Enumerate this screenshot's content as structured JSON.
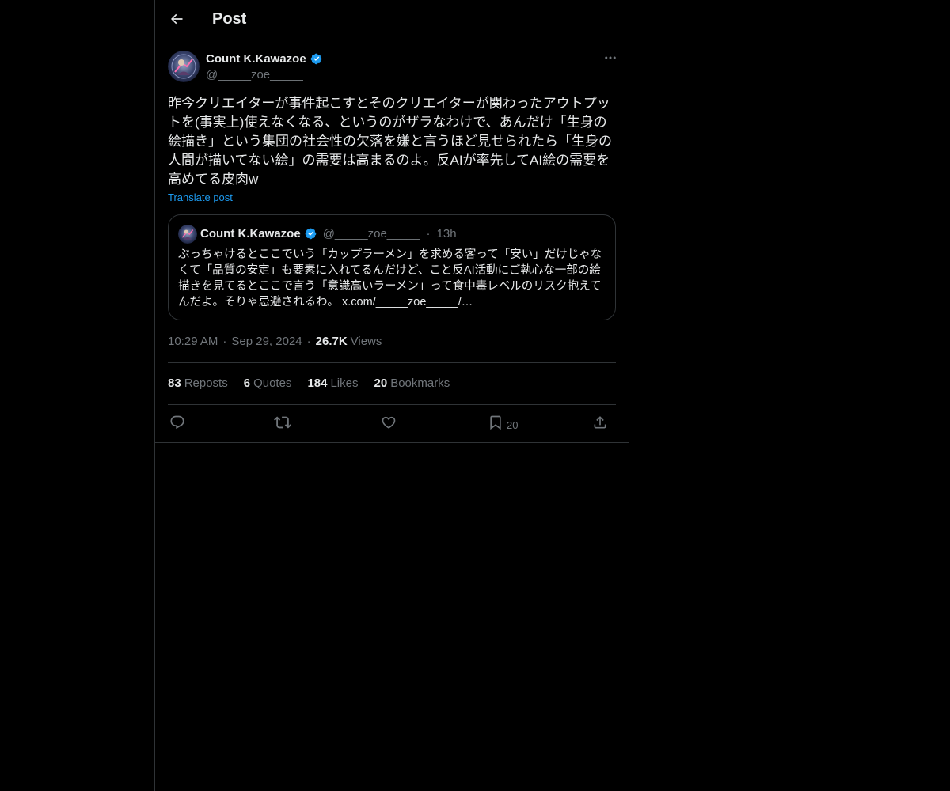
{
  "header": {
    "title": "Post"
  },
  "post": {
    "author_name": "Count K.Kawazoe",
    "author_handle": "@_____zoe_____",
    "text": "昨今クリエイターが事件起こすとそのクリエイターが関わったアウトプットを(事実上)使えなくなる、というのがザラなわけで、あんだけ「生身の絵描き」という集団の社会性の欠落を嫌と言うほど見せられたら「生身の人間が描いてない絵」の需要は高まるのよ。反AIが率先してAI絵の需要を高めてる皮肉w",
    "translate_label": "Translate post",
    "time": "10:29 AM",
    "date": "Sep 29, 2024",
    "views_count": "26.7K",
    "views_label": "Views"
  },
  "quote": {
    "author_name": "Count K.Kawazoe",
    "author_handle": "@_____zoe_____",
    "dot": "·",
    "time": "13h",
    "text": "ぶっちゃけるとここでいう「カップラーメン」を求める客って「安い」だけじゃなくて「品質の安定」も要素に入れてるんだけど、こと反AI活動にご執心な一部の絵描きを見てるとここで言う「意識高いラーメン」って食中毒レベルのリスク抱えてんだよ。そりゃ忌避されるわ。 x.com/_____zoe_____/…"
  },
  "meta_sep": "·",
  "stats": {
    "reposts": {
      "count": "83",
      "label": "Reposts"
    },
    "quotes": {
      "count": "6",
      "label": "Quotes"
    },
    "likes": {
      "count": "184",
      "label": "Likes"
    },
    "bookmarks": {
      "count": "20",
      "label": "Bookmarks"
    }
  },
  "actions": {
    "bookmark_count": "20"
  },
  "icons": {
    "back": "arrow-left-icon",
    "more": "more-horizontal-icon",
    "verified": "verified-badge-icon",
    "reply": "reply-icon",
    "repost": "repost-icon",
    "like": "heart-icon",
    "bookmark": "bookmark-icon",
    "share": "share-icon"
  },
  "colors": {
    "background": "#000000",
    "text": "#e7e9ea",
    "secondary": "#71767b",
    "accent": "#1d9bf0",
    "border": "#2f3336"
  }
}
